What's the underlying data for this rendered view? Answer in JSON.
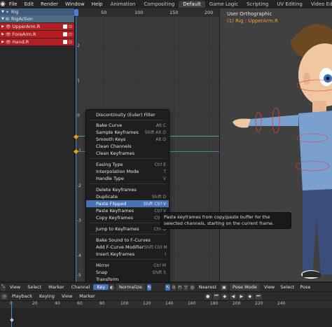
{
  "topbar": {
    "menus": [
      "File",
      "Edit",
      "Render",
      "Window",
      "Help"
    ],
    "workspaces": [
      "Animation",
      "Compositing",
      "Default",
      "Game Logic",
      "Scripting",
      "UV Editing",
      "Video Editing"
    ],
    "active_workspace": "Default"
  },
  "channels": {
    "rig": "Rig",
    "action": "RigAction",
    "bones": [
      "UpperArm.R",
      "ForeArm.R",
      "Hand.R"
    ],
    "bone_color": "#b41e22"
  },
  "graph": {
    "ruler_ticks": [
      "0",
      "50",
      "100",
      "150",
      "200"
    ],
    "y_labels": [
      "2",
      "1",
      "0",
      "-1",
      "-2",
      "-3",
      "-4",
      "-5"
    ],
    "current_frame": "1"
  },
  "viewport": {
    "title": "User Orthographic",
    "subtitle": "(1) Rig : UpperArm.R"
  },
  "context_menu": {
    "items": [
      {
        "label": "Discontinuity (Euler) Filter",
        "shortcut": ""
      },
      {
        "label": "Bake Curve",
        "shortcut": "Alt C"
      },
      {
        "label": "Sample Keyframes",
        "shortcut": "Shift Alt O"
      },
      {
        "label": "Smooth Keys",
        "shortcut": "Alt O"
      },
      {
        "label": "Clean Channels",
        "shortcut": ""
      },
      {
        "label": "Clean Keyframes",
        "shortcut": ""
      },
      {
        "label": "Easing Type",
        "shortcut": "Ctrl E"
      },
      {
        "label": "Interpolation Mode",
        "shortcut": "T"
      },
      {
        "label": "Handle Type",
        "shortcut": "V"
      },
      {
        "label": "Delete Keyframes",
        "shortcut": ""
      },
      {
        "label": "Duplicate",
        "shortcut": "Shift D"
      },
      {
        "label": "Paste Flipped",
        "shortcut": "Shift Ctrl V"
      },
      {
        "label": "Paste Keyframes",
        "shortcut": "Ctrl V"
      },
      {
        "label": "Copy Keyframes",
        "shortcut": "Ctrl C"
      },
      {
        "label": "Jump to Keyframes",
        "shortcut": "Ctrl G"
      },
      {
        "label": "Bake Sound to F-Curves",
        "shortcut": ""
      },
      {
        "label": "Add F-Curve Modifier",
        "shortcut": "Shift Ctrl M"
      },
      {
        "label": "Insert Keyframes",
        "shortcut": "I"
      },
      {
        "label": "Mirror",
        "shortcut": "Ctrl M"
      },
      {
        "label": "Snap",
        "shortcut": "Shift S"
      },
      {
        "label": "Transform",
        "shortcut": ""
      }
    ],
    "highlighted": "Paste Flipped"
  },
  "tooltip": {
    "text": "Paste keyframes from copy/paste buffer for the selected channels, starting on the current frame."
  },
  "graph_header": {
    "items": [
      "View",
      "Select",
      "Marker",
      "Channel",
      "Key"
    ],
    "active": "Key",
    "normalize": "Normalize",
    "pivot": "Nearest"
  },
  "viewport_header": {
    "mode": "Pose Mode",
    "items": [
      "View",
      "Select",
      "Pose"
    ]
  },
  "timeline": {
    "items": [
      "Playback",
      "Keying",
      "View",
      "Marker"
    ],
    "ticks": [
      "0",
      "20",
      "40",
      "60",
      "80",
      "100",
      "120",
      "140",
      "160",
      "180",
      "200",
      "220",
      "240"
    ]
  },
  "colors": {
    "accent": "#4772b3",
    "keyframe": "#f0a000",
    "frame_line": "#4f84d9"
  }
}
